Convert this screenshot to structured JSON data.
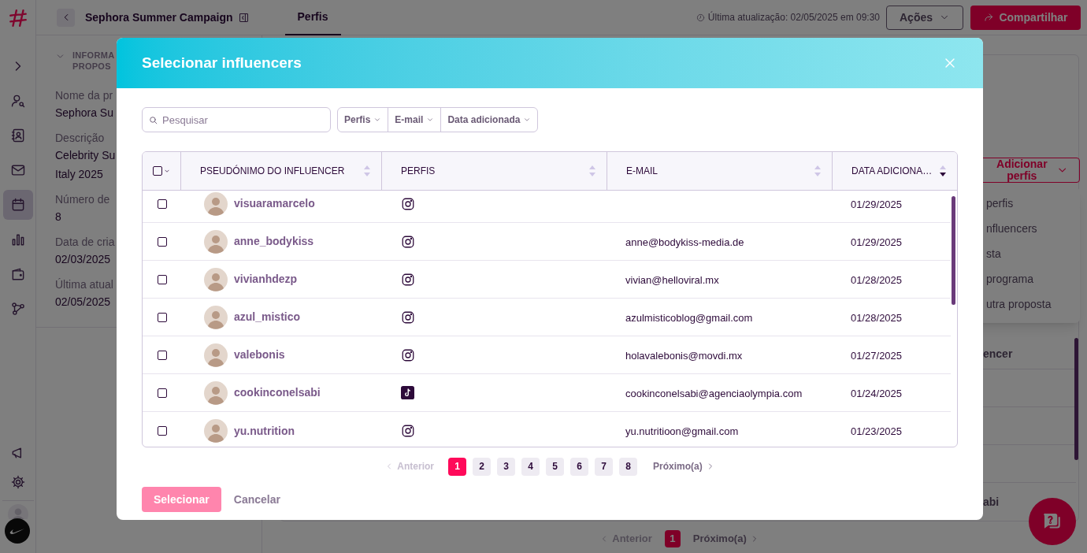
{
  "sidebar": {
    "items": [
      {
        "kind": "expand",
        "selected": false
      },
      {
        "kind": "user-search",
        "selected": false
      },
      {
        "kind": "contacts",
        "selected": false
      },
      {
        "kind": "mail",
        "selected": false
      },
      {
        "kind": "calendar",
        "selected": true
      },
      {
        "kind": "chart",
        "selected": false
      },
      {
        "kind": "wallet",
        "selected": false
      },
      {
        "kind": "network",
        "selected": false
      }
    ],
    "bottom_items": [
      {
        "kind": "megaphone"
      },
      {
        "kind": "settings"
      }
    ]
  },
  "header": {
    "title": "Sephora Summer Campaign",
    "tabs": [
      {
        "label": "Perfis",
        "selected": true
      }
    ],
    "last_update": "Última atualização: 02/05/2025 em 09:30",
    "actions_button": "Ações",
    "share_button": "Compartilhar"
  },
  "proposal_panel": {
    "heading": [
      "INFORMA",
      "PROPOS"
    ],
    "fields": [
      {
        "label": "Nome da pr",
        "value": [
          "Sephora Su"
        ]
      },
      {
        "label": "Descrição",
        "value": [
          "Celebrity Su",
          "Italy 2025"
        ]
      },
      {
        "label": "Número de",
        "value": [
          "8"
        ]
      },
      {
        "label": "Data de cria",
        "value": [
          "02/03/2025"
        ]
      },
      {
        "label": "Última atual",
        "value": [
          "02/05/2025"
        ]
      }
    ]
  },
  "right_panel": {
    "add_button": "Adicionar perfis",
    "menu_items": [
      "perfis",
      "nfluencers",
      "sta",
      "programa",
      "utra proposta"
    ],
    "row_texts": [
      "encer",
      "abi"
    ]
  },
  "pagination": {
    "previous": "Anterior",
    "pages": [
      {
        "label": "1",
        "selected": true
      }
    ],
    "next": "Próximo(a)"
  },
  "modal": {
    "title": "Selecionar influencers",
    "search": {
      "placeholder": "Pesquisar"
    },
    "filters": [
      "Perfis",
      "E-mail",
      "Data adicionada"
    ],
    "select_all": {
      "checked": false
    },
    "columns": [
      {
        "label": "PSEUDÓNIMO DO INFLUENCER",
        "sorted_descending": false
      },
      {
        "label": "PERFIS",
        "sorted_descending": false
      },
      {
        "label": "E-MAIL",
        "sorted_descending": false
      },
      {
        "label": "DATA ADICIONA…",
        "sorted_descending": true
      }
    ],
    "rows": [
      {
        "checked": false,
        "name": "visuaramarcelo",
        "profile": {
          "kind": "instagram"
        },
        "date": "01/29/2025"
      },
      {
        "checked": false,
        "name": "anne_bodykiss",
        "profile": {
          "kind": "instagram"
        },
        "email": "anne@bodykiss-media.de",
        "date": "01/29/2025"
      },
      {
        "checked": false,
        "name": "vivianhdezp",
        "profile": {
          "kind": "instagram"
        },
        "email": "vivian@helloviral.mx",
        "date": "01/28/2025"
      },
      {
        "checked": false,
        "name": "azul_mistico",
        "profile": {
          "kind": "instagram"
        },
        "email": "azulmisticoblog@gmail.com",
        "date": "01/28/2025"
      },
      {
        "checked": false,
        "name": "valebonis",
        "profile": {
          "kind": "instagram"
        },
        "email": "holavalebonis@movdi.mx",
        "date": "01/27/2025"
      },
      {
        "checked": false,
        "name": "cookinconelsabi",
        "profile": {
          "kind": "tiktok"
        },
        "email": "cookinconelsabi@agenciaolympia.com",
        "date": "01/24/2025"
      },
      {
        "checked": false,
        "name": "yu.nutrition",
        "profile": {
          "kind": "instagram"
        },
        "email": "yu.nutritioon@gmail.com",
        "date": "01/23/2025"
      }
    ],
    "pagination": {
      "previous": {
        "label": "Anterior",
        "disabled": true
      },
      "pages": [
        {
          "label": "1",
          "selected": true
        },
        {
          "label": "2",
          "selected": false
        },
        {
          "label": "3",
          "selected": false
        },
        {
          "label": "4",
          "selected": false
        },
        {
          "label": "5",
          "selected": false
        },
        {
          "label": "6",
          "selected": false
        },
        {
          "label": "7",
          "selected": false
        },
        {
          "label": "8",
          "selected": false
        }
      ],
      "next": {
        "label": "Próximo(a)",
        "disabled": false
      }
    },
    "select_button": {
      "label": "Selecionar",
      "disabled": true
    },
    "cancel_button": "Cancelar"
  }
}
